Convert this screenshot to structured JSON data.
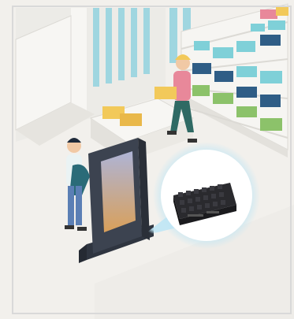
{
  "illustration": {
    "palette": {
      "floor": "#f2f0ec",
      "wall": "#ecebe7",
      "stripe": "#9fd6e0",
      "shelf": "#f6f5f2",
      "kiosk": "#3c4350",
      "screen_top": "#aeb4d6",
      "screen_bottom": "#d9a05a",
      "device": "#2a2a2e",
      "bubble_glow": "#bfe6f5",
      "box_teal": "#7fd0d8",
      "box_navy": "#2f5d86",
      "box_green": "#8cc26a",
      "box_yellow": "#f2c95a",
      "box_pink": "#e8889a"
    },
    "icons": [
      "kiosk-display-icon",
      "edge-computer-device-icon",
      "shopper-figure",
      "staff-figure",
      "shelf-icon"
    ]
  }
}
